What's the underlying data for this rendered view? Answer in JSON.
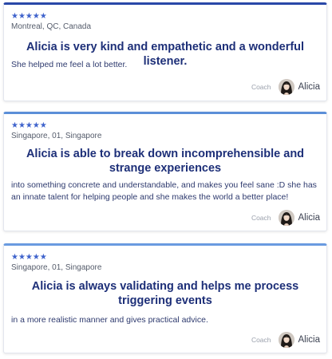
{
  "reviews": [
    {
      "rating": "★★★★★",
      "location": "Montreal, QC, Canada",
      "headline": "Alicia is very kind and empathetic and a wonderful listener.",
      "body": "She helped me feel a lot better.",
      "coach_label": "Coach",
      "coach_name": "Alicia"
    },
    {
      "rating": "★★★★★",
      "location": "Singapore, 01, Singapore",
      "headline": "Alicia is able to break down incomprehensible and strange experiences",
      "body": "into something concrete and understandable, and makes you feel sane :D she has an innate talent for helping people and she makes the world a better place!",
      "coach_label": "Coach",
      "coach_name": "Alicia"
    },
    {
      "rating": "★★★★★",
      "location": "Singapore, 01, Singapore",
      "headline": "Alicia is always validating and helps me process triggering events",
      "body": "in a more realistic manner and gives practical advice.",
      "coach_label": "Coach",
      "coach_name": "Alicia"
    }
  ],
  "colors": {
    "accent": "#2f58c4",
    "stars": "#3f63cc",
    "headline": "#1d2f78",
    "body": "#2e3a6e"
  },
  "icons": {
    "rating": "star-icon",
    "avatar": "coach-avatar-photo"
  }
}
